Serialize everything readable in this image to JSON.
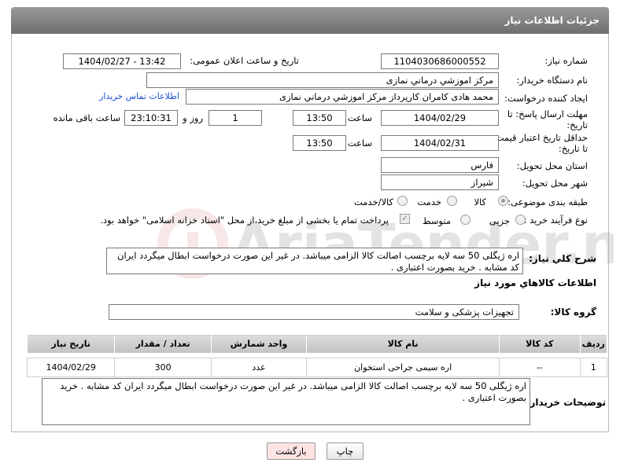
{
  "page_title": "جزئیات اطلاعات نیاز",
  "fields": {
    "need_number_label": "شماره نیاز:",
    "need_number": "1104030686000552",
    "announce_label": "تاریخ و ساعت اعلان عمومی:",
    "announce_value": "1404/02/27 - 13:42",
    "buyer_org_label": "نام دستگاه خریدار:",
    "buyer_org": "مرکز اموزشي درماني نمازی",
    "requester_label": "ایجاد کننده درخواست:",
    "requester": "محمد هادی کامران کارپرداز مرکز اموزشي درماني نمازی",
    "contact_link": "اطلاعات تماس خریدار",
    "deadline_label_1": "مهلت ارسال پاسخ: تا",
    "deadline_label_2": "تاریخ:",
    "deadline_date": "1404/02/29",
    "time_label": "ساعت",
    "deadline_time": "13:50",
    "days_value": "1",
    "days_label": "روز و",
    "remaining_time": "23:10:31",
    "remaining_label": "ساعت باقی مانده",
    "min_price_label_1": "حداقل تاریخ اعتبار قیمت:",
    "min_price_label_2": "تا تاریخ:",
    "min_price_date": "1404/02/31",
    "min_price_time": "13:50",
    "province_label": "استان محل تحویل:",
    "province": "فارس",
    "city_label": "شهر محل تحویل:",
    "city": "شیراز",
    "category_label": "طبقه بندی موضوعی:",
    "category_options": [
      "کالا",
      "خدمت",
      "کالا/خدمت"
    ],
    "process_label": "نوع فرآیند خرید :",
    "process_options": [
      "جزیی",
      "متوسط"
    ],
    "payment_note": "پرداخت تمام یا بخشی از مبلغ خرید،از محل \"اسناد خزانه اسلامی\" خواهد بود.",
    "description_label": "شرح کلي نياز:",
    "description": "اره ژیگلی  50 سه لایه برچسب اصالت کالا الزامی میباشد. در غیر این صورت درخواست ابطال میگردد ایران کد مشابه . خرید بصورت اعتباری ."
  },
  "goods_section": {
    "title": "اطلاعات کالاهاي مورد نياز",
    "group_label": "گروه کالا:",
    "group_value": "تجهیزات پزشکی و سلامت"
  },
  "table": {
    "headers": [
      "ردیف",
      "کد کالا",
      "نام کالا",
      "واحد شمارش",
      "تعداد / مقدار",
      "تاریخ نیاز"
    ],
    "rows": [
      [
        "1",
        "--",
        "اره سیمی جراحی استخوان",
        "عدد",
        "300",
        "1404/02/29"
      ]
    ]
  },
  "buyer_notes": {
    "label": "توضیحات خریدار:",
    "text": "اره ژیگلی  50 سه لایه برچسب اصالت کالا الزامی میباشد. در غیر این صورت درخواست ابطال میگردد ایران کد مشابه . خرید بصورت اعتباری ."
  },
  "buttons": {
    "print": "چاپ",
    "back": "بازگشت"
  },
  "watermark_text": "AriaTender.neT",
  "colors": {
    "title_bar": "#7f7f7f",
    "link": "#1a4fd6",
    "back_button": "#fde4e4"
  }
}
